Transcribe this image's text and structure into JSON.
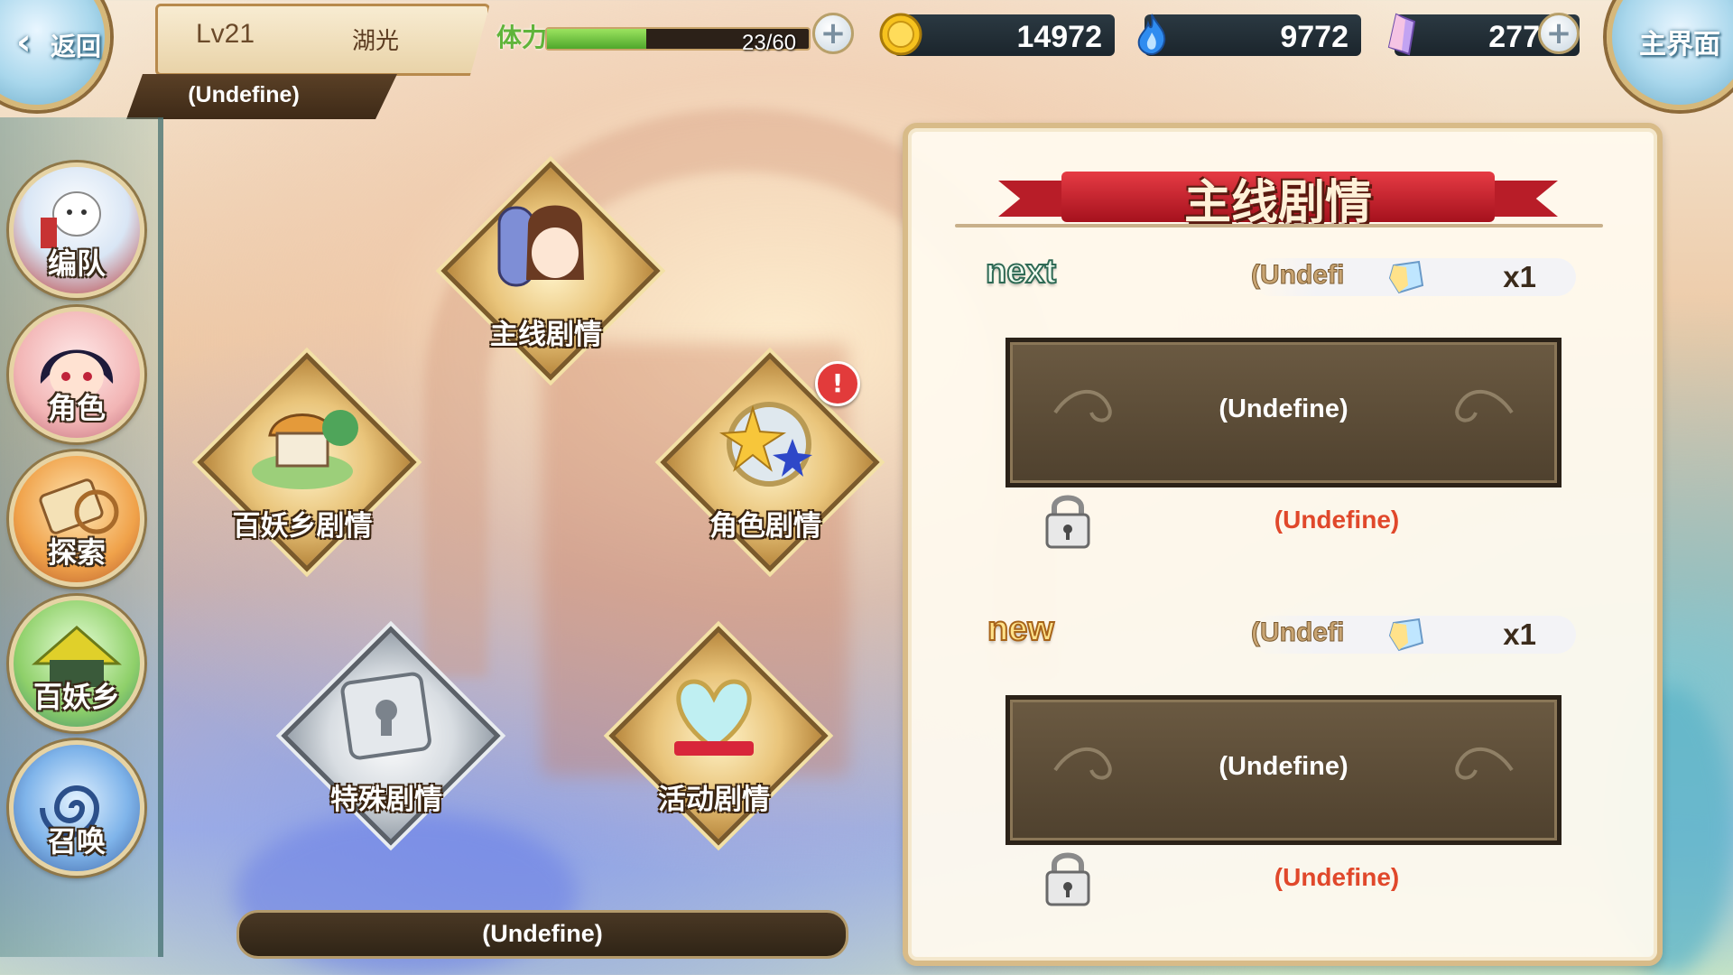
{
  "header": {
    "back_label": "返回",
    "level": "Lv21",
    "player_name": "湖光",
    "player_title": "(Undefine)",
    "home_label": "主界面"
  },
  "stamina": {
    "label": "体力",
    "value_text": "23/60",
    "fill_percent": 38
  },
  "currencies": {
    "gold": "14972",
    "soul_fire": "9772",
    "crystal": "277"
  },
  "sidebar": {
    "items": [
      {
        "label": "编队",
        "icon": "team-icon"
      },
      {
        "label": "角色",
        "icon": "character-icon"
      },
      {
        "label": "探索",
        "icon": "explore-icon"
      },
      {
        "label": "百妖乡",
        "icon": "village-icon"
      },
      {
        "label": "召唤",
        "icon": "summon-icon"
      }
    ]
  },
  "story_menu": {
    "main": "主线剧情",
    "village": "百妖乡剧情",
    "character": "角色剧情",
    "special": "特殊剧情",
    "event": "活动剧情",
    "alert_badge": "!"
  },
  "bottom_bar": "(Undefine)",
  "panel": {
    "title": "主线剧情",
    "next": {
      "label": "next",
      "reward_name": "(Undefi",
      "reward_qty": "x1",
      "slot_text": "(Undefine)",
      "lock_text": "(Undefine)"
    },
    "new": {
      "label": "new",
      "reward_name": "(Undefi",
      "reward_qty": "x1",
      "slot_text": "(Undefine)",
      "lock_text": "(Undefine)"
    }
  },
  "colors": {
    "accent_gold": "#d8bb88",
    "ribbon_red": "#c01f2a",
    "lock_text": "#e0482b",
    "stamina_green": "#5fb43a"
  }
}
